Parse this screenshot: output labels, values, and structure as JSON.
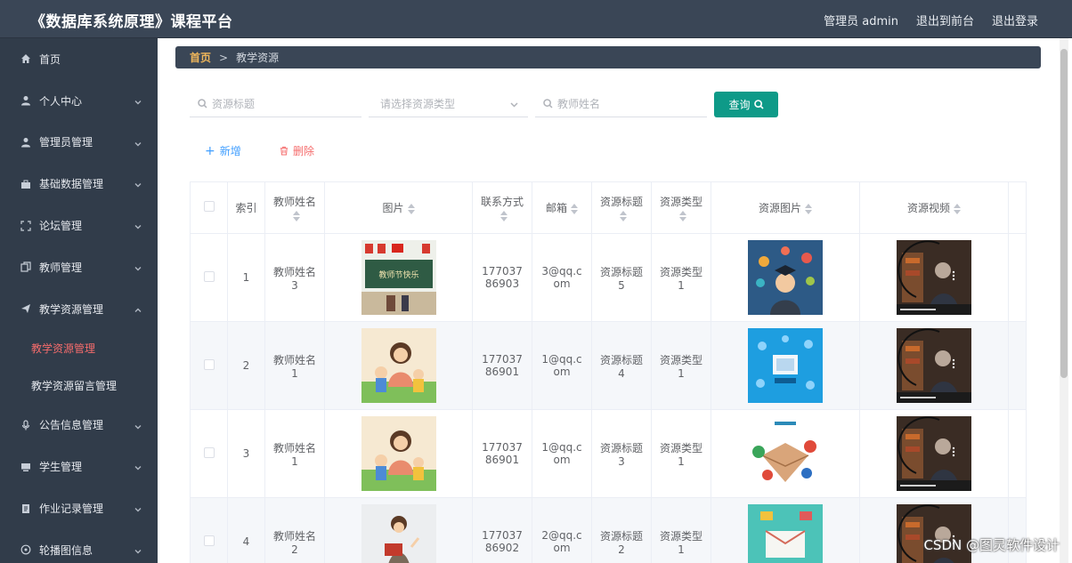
{
  "app": {
    "title": "《数据库系统原理》课程平台",
    "admin_label": "管理员 admin",
    "front_link": "退出到前台",
    "logout_link": "退出登录"
  },
  "sidebar": {
    "items": [
      {
        "label": "首页",
        "icon": "home-icon"
      },
      {
        "label": "个人中心",
        "icon": "user-icon"
      },
      {
        "label": "管理员管理",
        "icon": "user-icon"
      },
      {
        "label": "基础数据管理",
        "icon": "briefcase-icon"
      },
      {
        "label": "论坛管理",
        "icon": "frame-icon"
      },
      {
        "label": "教师管理",
        "icon": "copy-icon"
      },
      {
        "label": "教学资源管理",
        "icon": "send-icon"
      },
      {
        "label": "公告信息管理",
        "icon": "microphone-icon"
      },
      {
        "label": "学生管理",
        "icon": "monitor-icon"
      },
      {
        "label": "作业记录管理",
        "icon": "document-icon"
      },
      {
        "label": "轮播图信息",
        "icon": "compass-icon"
      }
    ],
    "subitems": [
      "教学资源管理",
      "教学资源留言管理"
    ]
  },
  "breadcrumb": {
    "home": "首页",
    "separator": ">",
    "current": "教学资源"
  },
  "search": {
    "title_placeholder": "资源标题",
    "type_placeholder": "请选择资源类型",
    "teacher_placeholder": "教师姓名",
    "query_label": "查询"
  },
  "actions": {
    "add_label": "新增",
    "delete_label": "删除"
  },
  "table": {
    "headers": [
      "索引",
      "教师姓名",
      "图片",
      "联系方式",
      "邮箱",
      "资源标题",
      "资源类型",
      "资源图片",
      "资源视频"
    ],
    "rows": [
      {
        "index": "1",
        "teacher": "教师姓名3",
        "phone": "17703786903",
        "email": "3@qq.com",
        "title": "资源标题5",
        "type": "资源类型1"
      },
      {
        "index": "2",
        "teacher": "教师姓名1",
        "phone": "17703786901",
        "email": "1@qq.com",
        "title": "资源标题4",
        "type": "资源类型1"
      },
      {
        "index": "3",
        "teacher": "教师姓名1",
        "phone": "17703786901",
        "email": "1@qq.com",
        "title": "资源标题3",
        "type": "资源类型1"
      },
      {
        "index": "4",
        "teacher": "教师姓名2",
        "phone": "17703786902",
        "email": "2@qq.com",
        "title": "资源标题2",
        "type": "资源类型1"
      }
    ]
  },
  "watermark": "CSDN @图灵软件设计",
  "colors": {
    "accent": "#0e9a88",
    "header_bg": "#3a4656",
    "sidebar_bg": "#313c4a",
    "active_menu": "#f56c6c",
    "link_blue": "#409eff"
  }
}
